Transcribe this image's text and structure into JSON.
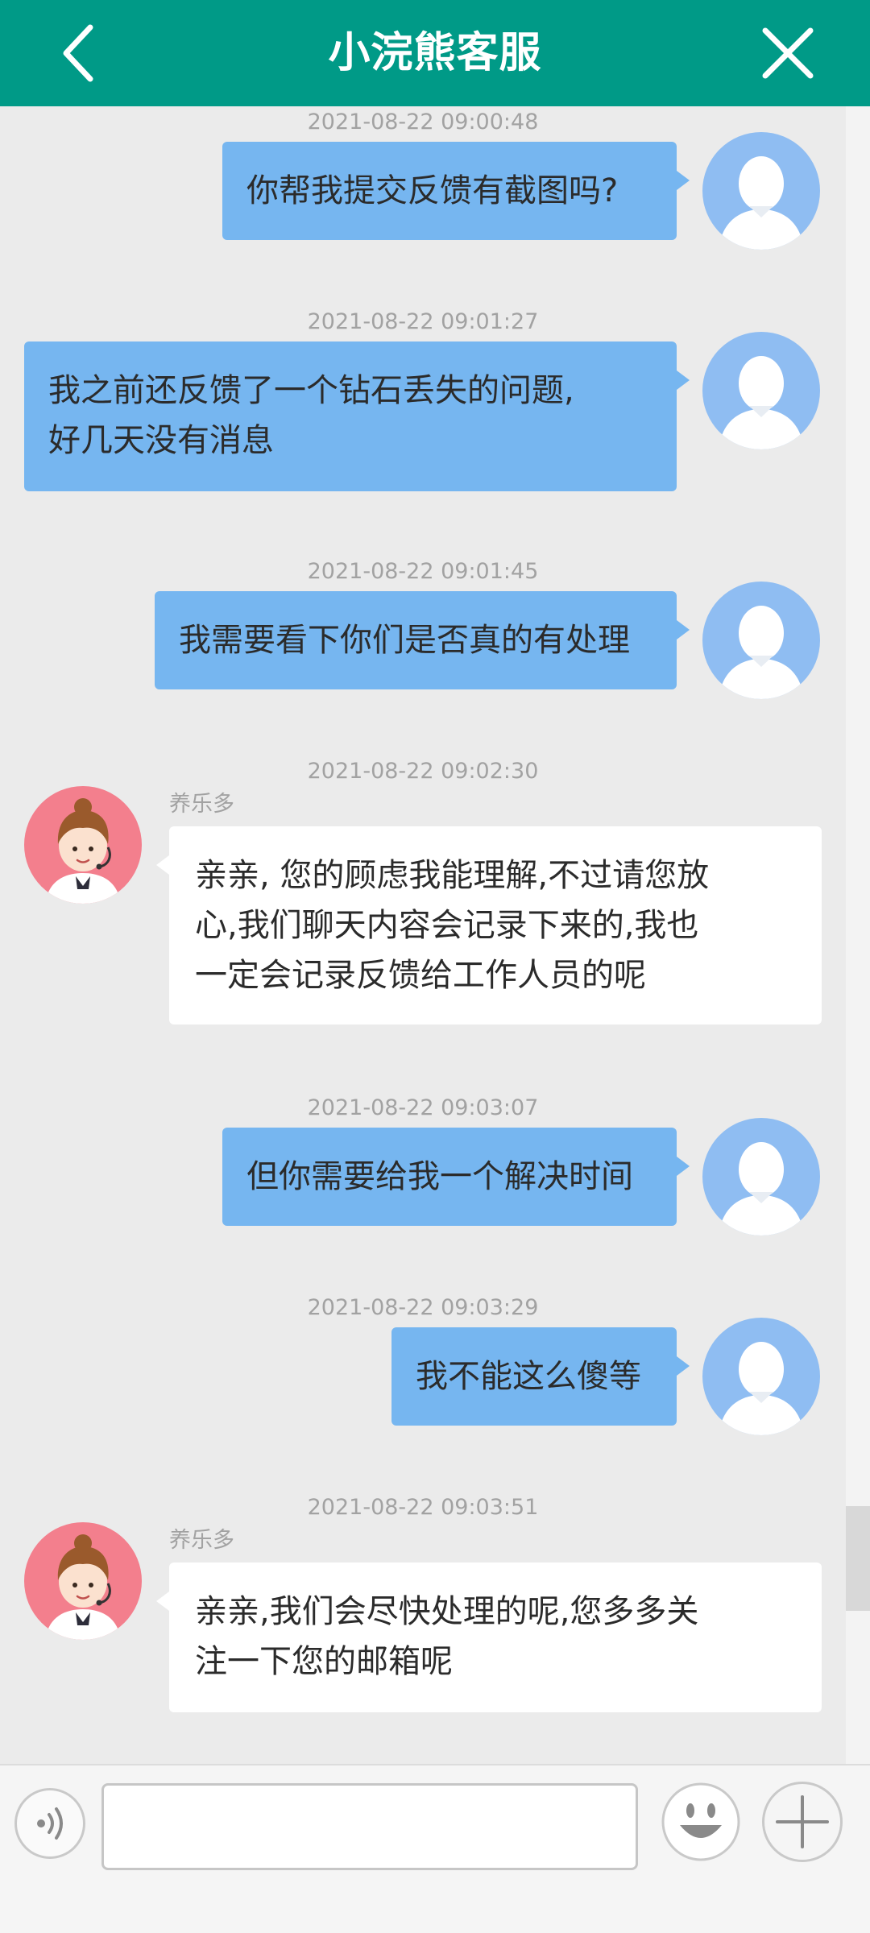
{
  "header": {
    "title": "小浣熊客服",
    "back_icon": "chevron-left-icon",
    "close_icon": "close-icon"
  },
  "colors": {
    "header_bg": "#009a87",
    "user_bubble": "#76b6f0",
    "agent_bubble": "#ffffff",
    "chat_bg": "#ebebeb"
  },
  "messages": [
    {
      "side": "user",
      "time": "2021-08-22 09:00:48",
      "lines": [
        "你帮我提交反馈有截图吗?"
      ]
    },
    {
      "side": "user",
      "time": "2021-08-22 09:01:27",
      "lines": [
        "我之前还反馈了一个钻石丢失的问题,",
        "好几天没有消息"
      ]
    },
    {
      "side": "user",
      "time": "2021-08-22 09:01:45",
      "lines": [
        "我需要看下你们是否真的有处理"
      ]
    },
    {
      "side": "agent",
      "time": "2021-08-22 09:02:30",
      "sender": "养乐多",
      "lines": [
        "亲亲, 您的顾虑我能理解,不过请您放",
        "心,我们聊天内容会记录下来的,我也",
        "一定会记录反馈给工作人员的呢"
      ]
    },
    {
      "side": "user",
      "time": "2021-08-22 09:03:07",
      "lines": [
        "但你需要给我一个解决时间"
      ]
    },
    {
      "side": "user",
      "time": "2021-08-22 09:03:29",
      "lines": [
        "我不能这么傻等"
      ]
    },
    {
      "side": "agent",
      "time": "2021-08-22 09:03:51",
      "sender": "养乐多",
      "lines": [
        "亲亲,我们会尽快处理的呢,您多多关",
        "注一下您的邮箱呢"
      ]
    }
  ],
  "input": {
    "value": "",
    "placeholder": ""
  },
  "toolbar": {
    "voice_icon": "voice-icon",
    "emoji_icon": "emoji-icon",
    "plus_icon": "plus-icon"
  }
}
